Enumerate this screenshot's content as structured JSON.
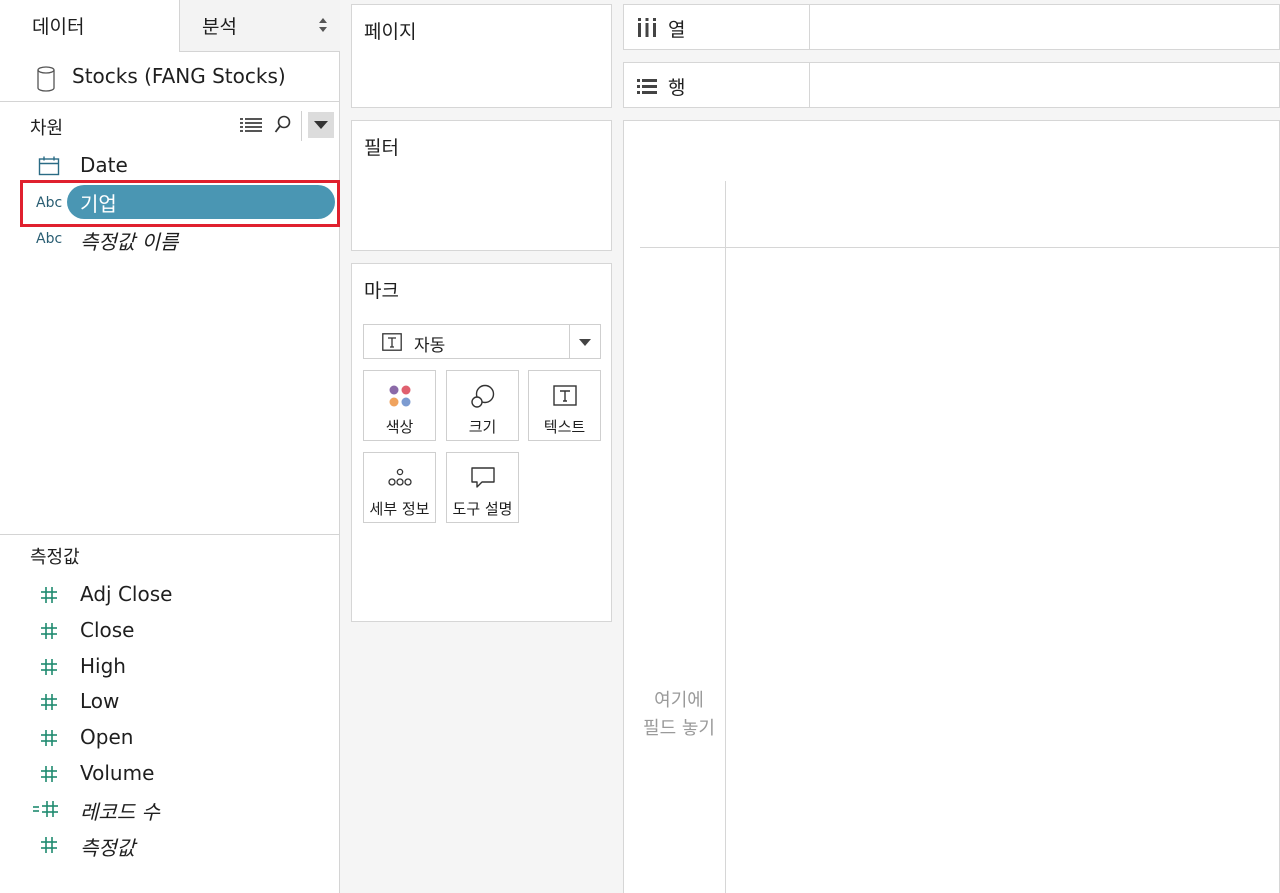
{
  "data_pane": {
    "tabs": {
      "data": "데이터",
      "analysis": "분석"
    },
    "datasource": "Stocks (FANG Stocks)",
    "dimensions": {
      "title": "차원",
      "items": [
        {
          "type": "date-icon",
          "label": "Date"
        },
        {
          "type": "Abc",
          "label": "기업"
        },
        {
          "type": "Abc",
          "label": "측정값 이름"
        }
      ]
    },
    "measures": {
      "title": "측정값",
      "items": [
        {
          "label": "Adj Close"
        },
        {
          "label": "Close"
        },
        {
          "label": "High"
        },
        {
          "label": "Low"
        },
        {
          "label": "Open"
        },
        {
          "label": "Volume"
        },
        {
          "label": "레코드 수"
        },
        {
          "label": "측정값"
        }
      ]
    }
  },
  "cards": {
    "pages": "페이지",
    "filters": "필터",
    "marks": {
      "title": "마크",
      "type_value": "자동",
      "buttons": {
        "color": "색상",
        "size": "크기",
        "text": "텍스트",
        "detail": "세부 정보",
        "tooltip": "도구 설명"
      },
      "color_dots": [
        "#8b6aa8",
        "#e0606f",
        "#f0a35e",
        "#7c9bd1"
      ]
    }
  },
  "shelves": {
    "columns": "열",
    "rows": "행"
  },
  "view": {
    "drop_hint_line1": "여기에",
    "drop_hint_line2": "필드 놓기"
  },
  "colors": {
    "pill": "#4a96b3",
    "highlight": "#e0202e",
    "measure_icon": "#1f8a70"
  }
}
